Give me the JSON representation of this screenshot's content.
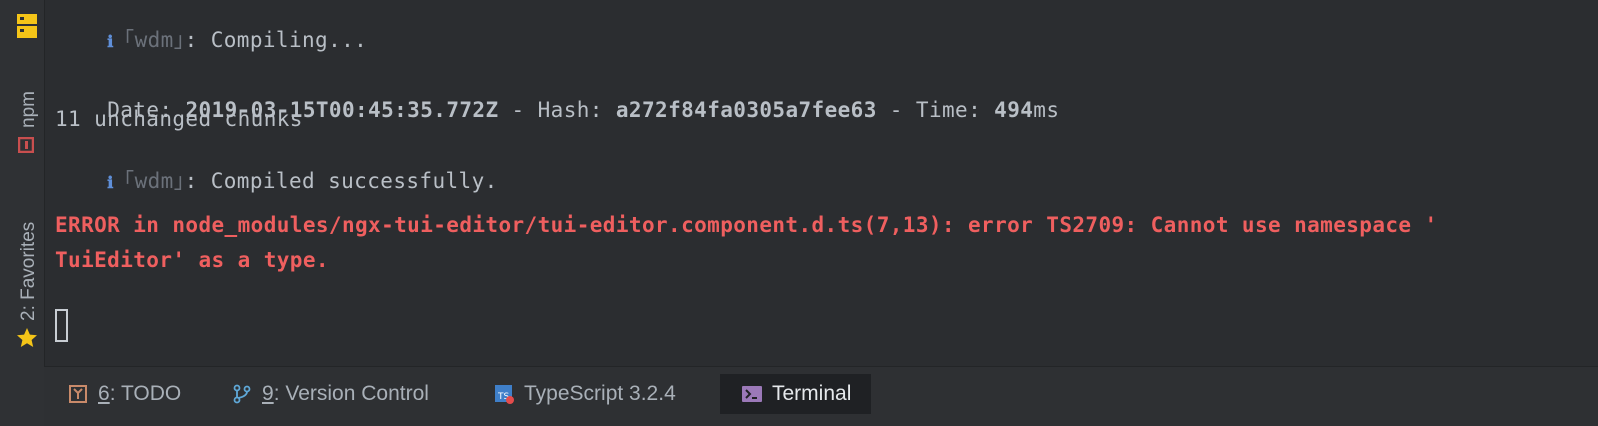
{
  "left_strip": {
    "npm_label": "npm",
    "favorites_label": "2: Favorites"
  },
  "terminal": {
    "info_symbol": "ℹ",
    "wdm_open": "｢",
    "wdm_word": "wdm",
    "wdm_close": "｣",
    "line1_text": ": Compiling...",
    "date_label": "Date: ",
    "date_value": "2019-03-15T00:45:35.772Z",
    "hash_sep": " - Hash: ",
    "hash_value": "a272f84fa0305a7fee63",
    "time_sep": " - Time: ",
    "time_value": "494",
    "time_unit": "ms",
    "chunks_line": "11 unchanged chunks",
    "line4_text": ": Compiled successfully.",
    "error_line1": "ERROR in node_modules/ngx-tui-editor/tui-editor.component.d.ts(7,13): error TS2709: Cannot use namespace '",
    "error_line2": "TuiEditor' as a type."
  },
  "bottom_bar": {
    "tabs": [
      {
        "mnemonic": "6",
        "label": ": TODO",
        "icon": "todo-icon"
      },
      {
        "mnemonic": "9",
        "label": ": Version Control",
        "icon": "branch-icon"
      },
      {
        "mnemonic": "",
        "label": "TypeScript 3.2.4",
        "icon": "typescript-icon"
      },
      {
        "mnemonic": "",
        "label": "Terminal",
        "icon": "terminal-icon",
        "active": true
      }
    ]
  },
  "colors": {
    "error": "#ef5f5f",
    "info": "#5f8fd8",
    "favorite_star": "#f5c518",
    "npm_accent": "#c94f4f"
  }
}
